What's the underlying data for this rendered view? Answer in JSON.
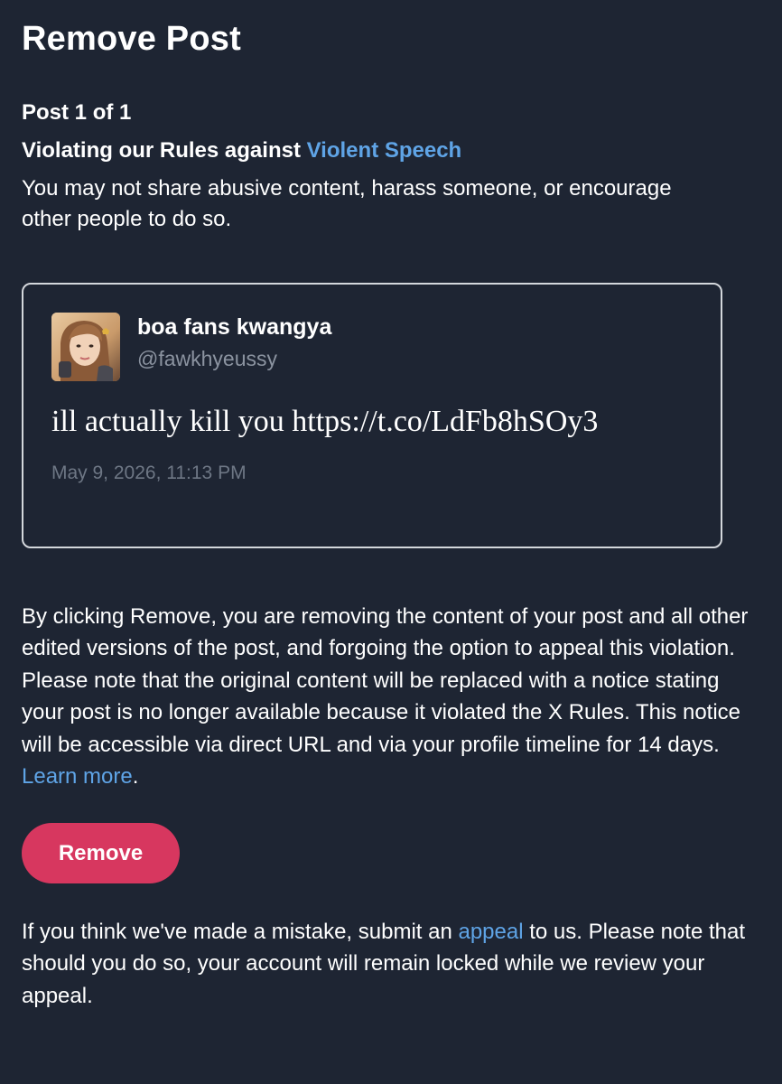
{
  "page": {
    "title": "Remove Post"
  },
  "violation": {
    "post_count": "Post 1 of 1",
    "heading_prefix": "Violating our Rules against ",
    "rule_link": "Violent Speech",
    "description": "You may not share abusive content, harass someone, or encourage other people to do so."
  },
  "post": {
    "display_name": "boa fans kwangya",
    "handle": "@fawkhyeussy",
    "text": "ill actually kill you https://t.co/LdFb8hSOy3",
    "timestamp": "May 9, 2026, 11:13 PM",
    "avatar_icon": "profile-photo"
  },
  "remove_notice": {
    "text": "By clicking Remove, you are removing the content of your post and all other edited versions of the post, and forgoing the option to appeal this violation. Please note that the original content will be replaced with a notice stating your post is no longer available because it violated the X Rules. This notice will be accessible via direct URL and via your profile timeline for 14 days. ",
    "learn_more_link": "Learn more",
    "suffix": "."
  },
  "actions": {
    "remove_label": "Remove"
  },
  "appeal_notice": {
    "prefix": "If you think we've made a mistake, submit an ",
    "appeal_link": "appeal",
    "suffix": " to us. Please note that should you do so, your account will remain locked while we review your appeal."
  },
  "colors": {
    "background": "#1e2533",
    "link": "#5fa4e6",
    "remove_button": "#d7375f",
    "card_border": "#d4d7dc",
    "muted_text": "#8b93a0"
  }
}
